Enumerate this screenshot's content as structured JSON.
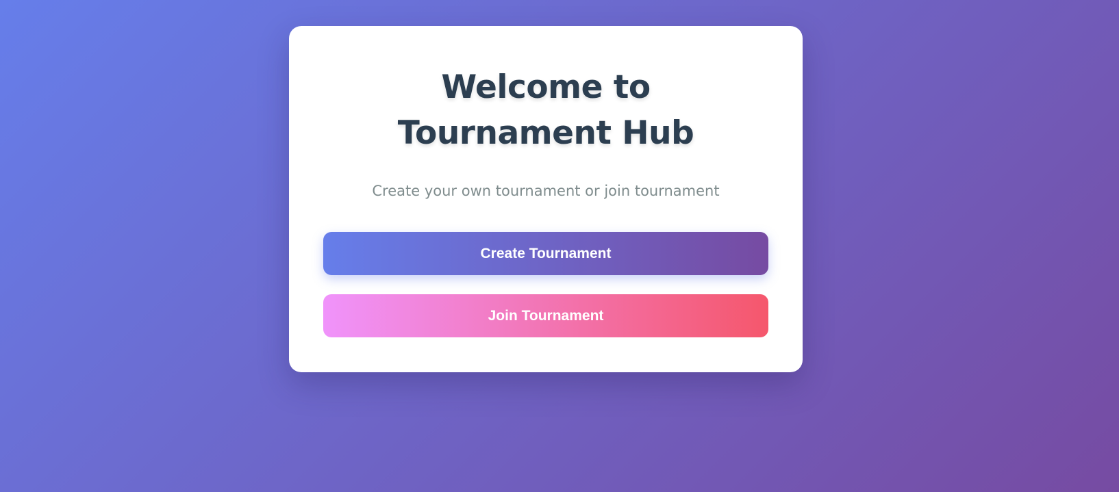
{
  "welcome": {
    "title": "Welcome to Tournament Hub",
    "subtitle": "Create your own tournament or join tournament",
    "create_button_label": "Create Tournament",
    "join_button_label": "Join Tournament"
  },
  "colors": {
    "background_start": "#667eea",
    "background_end": "#764ba2",
    "title_text": "#2c3e50",
    "subtitle_text": "#7f8c8d",
    "create_gradient_start": "#667eea",
    "create_gradient_end": "#764ba2",
    "join_gradient_start": "#f093fb",
    "join_gradient_end": "#f5576c"
  }
}
